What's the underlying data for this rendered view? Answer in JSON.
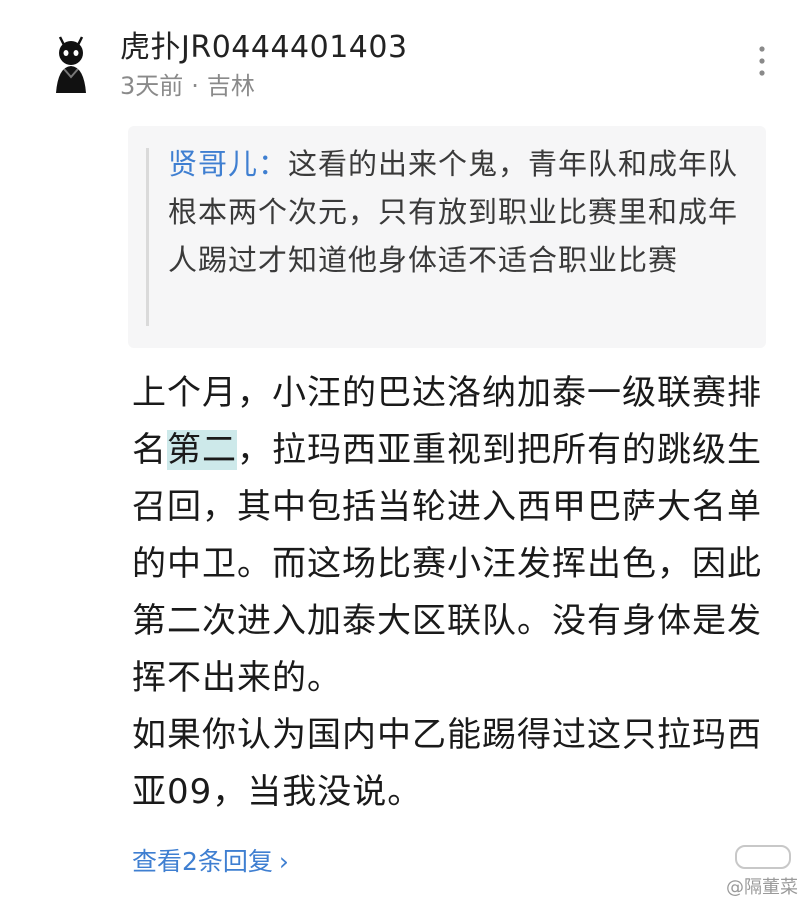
{
  "comment": {
    "username": "虎扑JR0444401403",
    "time": "3天前",
    "separator": "·",
    "location": "吉林",
    "more_icon": "vertical-dots-icon"
  },
  "quote": {
    "author": "贤哥儿：",
    "text": "这看的出来个鬼，青年队和成年队根本两个次元，只有放到职业比赛里和成年人踢过才知道他身体适不适合职业比赛"
  },
  "body": {
    "before_highlight": "上个月，小汪的巴达洛纳加泰一级联赛排名",
    "highlight": "第二",
    "after_highlight": "，拉玛西亚重视到把所有的跳级生召回，其中包括当轮进入西甲巴萨大名单的中卫。而这场比赛小汪发挥出色，因此第二次进入加泰大区联队。没有身体是发挥不出来的。",
    "paragraph2": "如果你认为国内中乙能踢得过这只拉玛西亚09，当我没说。"
  },
  "replies": {
    "label": "查看2条回复",
    "chevron": "›"
  },
  "watermark": {
    "text": "@隔董菜"
  },
  "colors": {
    "link": "#3f7fd1",
    "highlight": "#cde9ea",
    "quote_bg": "#f6f6f7",
    "meta": "#8a8a8a"
  }
}
